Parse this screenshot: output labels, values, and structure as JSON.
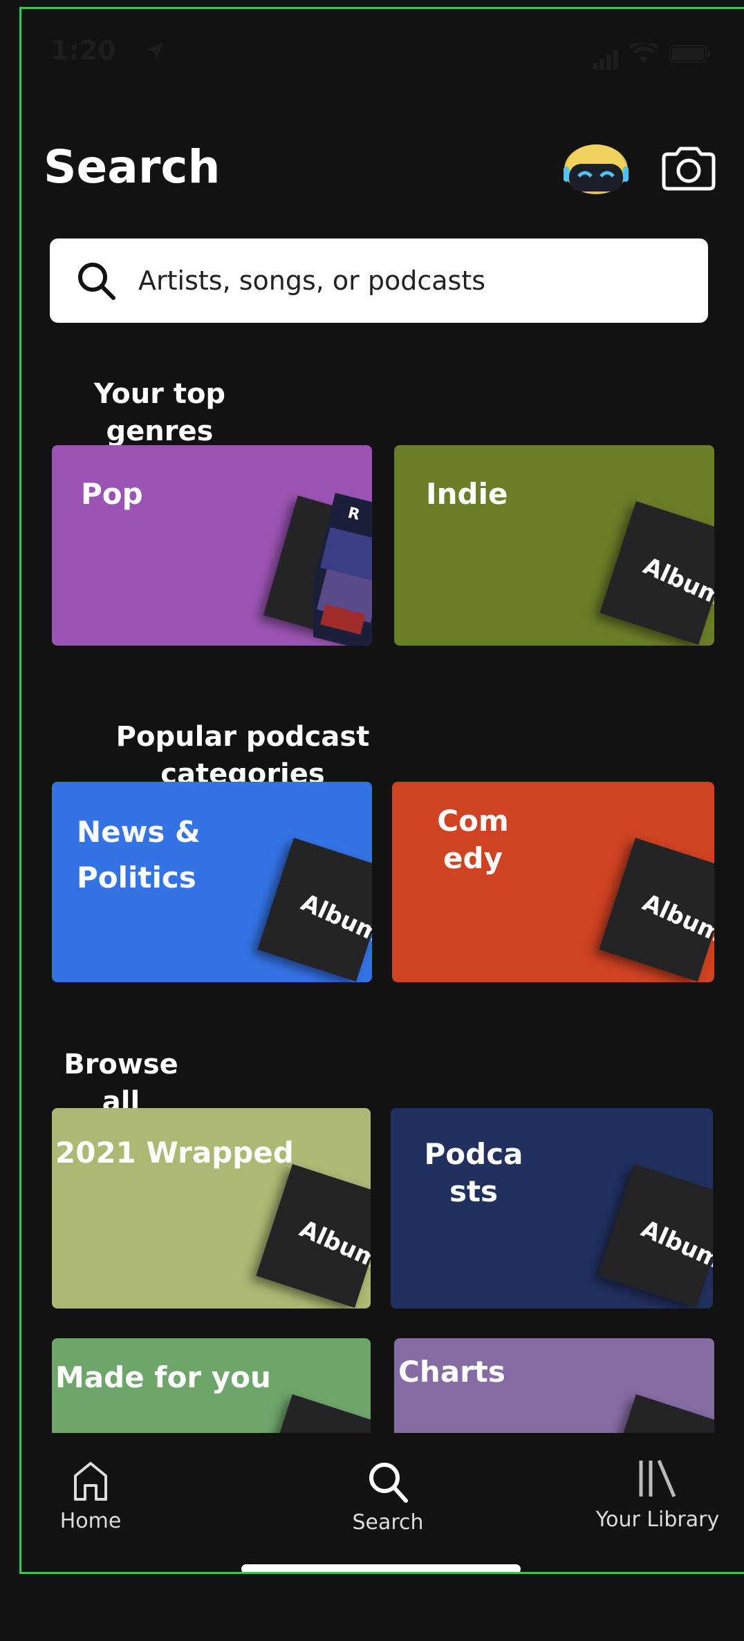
{
  "status_bar": {
    "time": "1:20"
  },
  "header": {
    "title": "Search"
  },
  "search": {
    "placeholder": "Artists, songs, or podcasts"
  },
  "sections": {
    "top_genres": "Your top genres",
    "podcast_categories": "Popular podcast categories",
    "browse_all": "Browse all"
  },
  "tiles": {
    "pop": {
      "label": "Pop",
      "color": "#9b54b3"
    },
    "indie": {
      "label": "Indie",
      "color": "#6a7d27",
      "art": "Album"
    },
    "news": {
      "label": "News & Politics",
      "color": "#3473e6",
      "art": "Album"
    },
    "comedy": {
      "label": "Com edy",
      "color": "#cf4222",
      "art": "Album"
    },
    "wrapped": {
      "label": "2021 Wrapped",
      "color": "#aab974",
      "art": "Album"
    },
    "podcasts": {
      "label": "Podca sts",
      "color": "#22305f",
      "art": "Album"
    },
    "made_for_you": {
      "label": "Made for you",
      "color": "#6ea56a"
    },
    "charts": {
      "label": "Charts",
      "color": "#866ca5"
    }
  },
  "nav": {
    "home": "Home",
    "search": "Search",
    "library": "Your Library"
  },
  "colors": {
    "background": "#121212",
    "frame": "#3ec55a"
  }
}
